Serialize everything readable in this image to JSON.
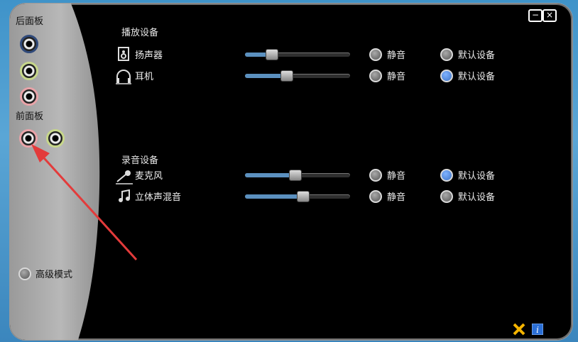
{
  "left": {
    "back_panel_label": "后面板",
    "front_panel_label": "前面板",
    "advanced_mode_label": "高级模式"
  },
  "playback": {
    "section_title": "播放设备",
    "devices": [
      {
        "name": "扬声器",
        "volume": 0.25,
        "mute_label": "静音",
        "default_label": "默认设备",
        "is_default": false
      },
      {
        "name": "耳机",
        "volume": 0.39,
        "mute_label": "静音",
        "default_label": "默认设备",
        "is_default": true
      }
    ]
  },
  "recording": {
    "section_title": "录音设备",
    "devices": [
      {
        "name": "麦克风",
        "volume": 0.47,
        "mute_label": "静音",
        "default_label": "默认设备",
        "is_default": true
      },
      {
        "name": "立体声混音",
        "volume": 0.55,
        "mute_label": "静音",
        "default_label": "默认设备",
        "is_default": false
      }
    ]
  },
  "window_controls": {
    "minimize": "−",
    "close": "×"
  },
  "icons": {
    "speaker": "speaker-icon",
    "headphone": "headphone-icon",
    "mic": "microphone-icon",
    "mix": "music-note-icon",
    "tools": "tools-icon",
    "info": "info-icon"
  },
  "colors": {
    "accent": "#5b90bf",
    "selected_radio": "#3d73c5",
    "arrow": "#e33b3b"
  }
}
